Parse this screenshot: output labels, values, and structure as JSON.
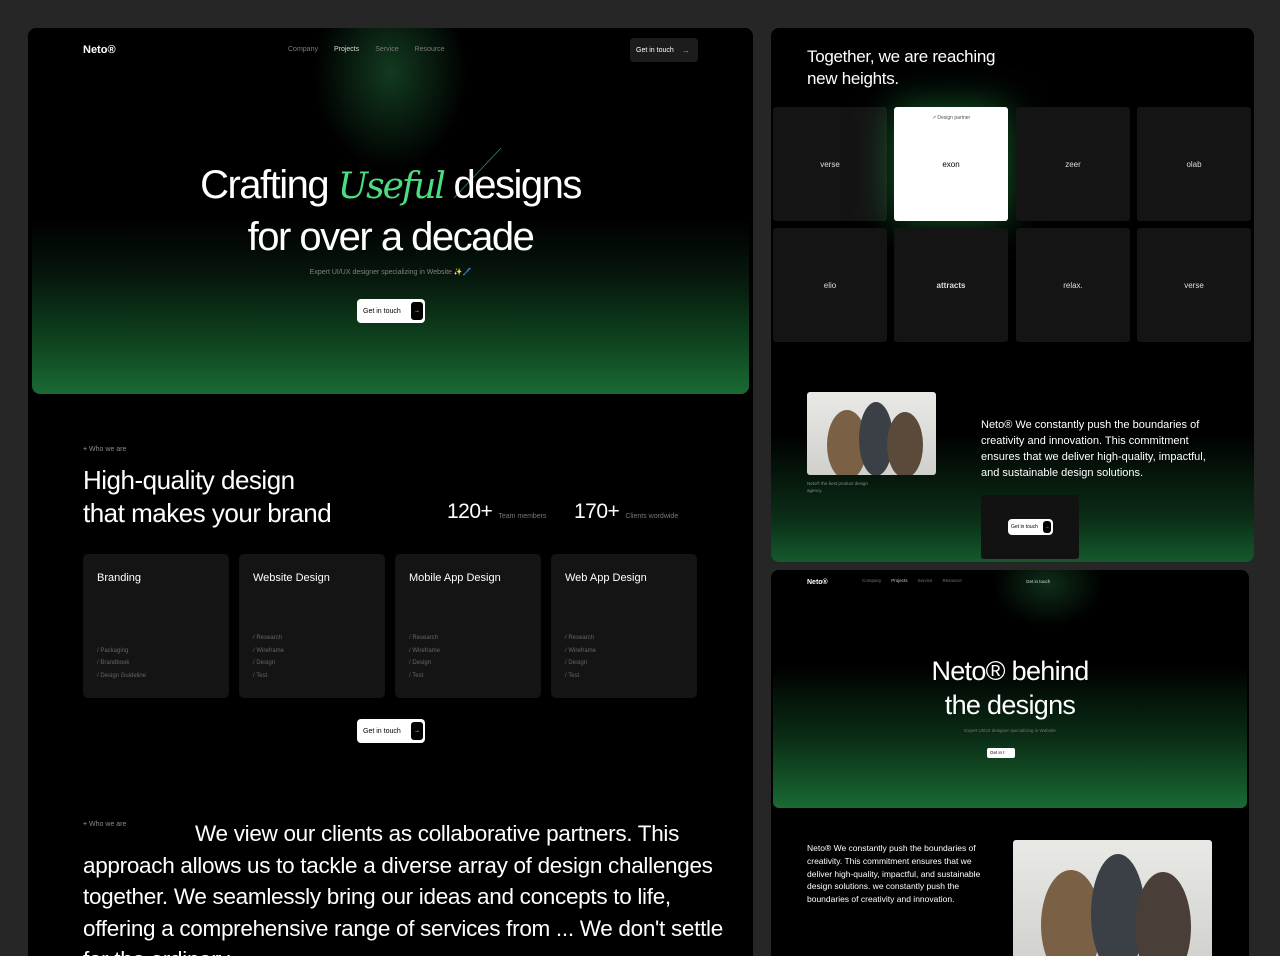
{
  "main": {
    "logo": "Neto®",
    "nav": [
      "Company",
      "Projects",
      "Service",
      "Resource"
    ],
    "nav_cta": "Get in touch",
    "hero": {
      "title_before": "Crafting ",
      "title_accent": "Useful",
      "title_after": " designs",
      "title_line2": "for over a decade",
      "subtitle": "Expert UI/UX designer specializing in Website ✨🖊️",
      "cta": "Get in touch"
    },
    "about": {
      "tag": "Who we are",
      "heading_line1": "High-quality design",
      "heading_line2": "that makes your brand",
      "stats": [
        {
          "value": "120+",
          "label": "Team members"
        },
        {
          "value": "170+",
          "label": "Clients wordwide"
        }
      ]
    },
    "services": [
      {
        "title": "Branding",
        "items": [
          "/ Packaging",
          "/ Brandbook",
          "/ Design Guideline"
        ]
      },
      {
        "title": "Website Design",
        "items": [
          "/ Research",
          "/ Wireframe",
          "/ Design",
          "/ Test"
        ]
      },
      {
        "title": "Mobile App Design",
        "items": [
          "/ Research",
          "/ Wireframe",
          "/ Design",
          "/ Test"
        ]
      },
      {
        "title": "Web App Design",
        "items": [
          "/ Research",
          "/ Wireframe",
          "/ Design",
          "/ Test"
        ]
      }
    ],
    "services_cta": "Get in touch",
    "clients": {
      "tag": "Who we are",
      "paragraph": "We view our clients as collaborative partners. This approach allows us to tackle a diverse array of design challenges together. We seamlessly bring our ideas and concepts to life, offering a comprehensive range of services from ... We don't settle for the ordinary"
    }
  },
  "partners": {
    "title": "Together, we are reaching new heights.",
    "design_partner_label": "↗ Design partner",
    "logos": [
      "verse",
      "exon",
      "zeer",
      "olab",
      "elio",
      "attracts",
      "relax.",
      "verse"
    ],
    "photo_caption": "Neto® the best product design agency.",
    "text": "Neto® We constantly push the boundaries of creativity and innovation. This commitment ensures that we deliver high-quality, impactful, and sustainable design solutions.",
    "cta": "Get in touch"
  },
  "secondary": {
    "logo": "Neto®",
    "nav": [
      "Company",
      "Projects",
      "Service",
      "Resource"
    ],
    "nav_cta": "Get in touch",
    "title_line1": "Neto® behind",
    "title_line2": "the designs",
    "subtitle": "Expert UI/UX designer specializing in Website",
    "cta": "Get in t",
    "text": "Neto® We constantly push the boundaries of creativity. This commitment ensures that we deliver high-quality, impactful, and sustainable design solutions. we constantly push the boundaries of creativity and innovation."
  }
}
